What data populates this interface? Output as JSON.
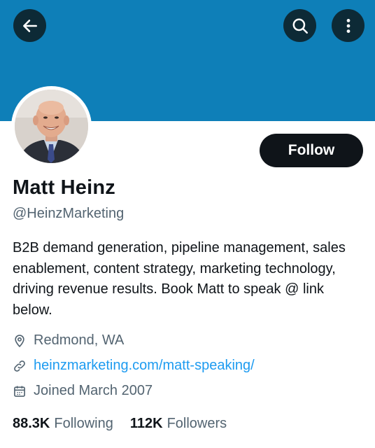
{
  "colors": {
    "banner": "#0e7fb8",
    "text_primary": "#0f1419",
    "text_secondary": "#536471",
    "link": "#1d9bf0",
    "follow_button": "#0f1419"
  },
  "header": {
    "back_icon": "arrow-left-icon",
    "search_icon": "search-icon",
    "more_icon": "more-vertical-icon"
  },
  "profile": {
    "follow_label": "Follow",
    "name": "Matt Heinz",
    "handle": "@HeinzMarketing",
    "bio": "B2B demand generation, pipeline management, sales enablement, content strategy, marketing technology, driving revenue results. Book Matt to speak @ link below.",
    "location": "Redmond, WA",
    "website": "heinzmarketing.com/matt-speaking/",
    "joined": "Joined March 2007"
  },
  "stats": {
    "following_count": "88.3K",
    "following_label": "Following",
    "followers_count": "112K",
    "followers_label": "Followers"
  }
}
